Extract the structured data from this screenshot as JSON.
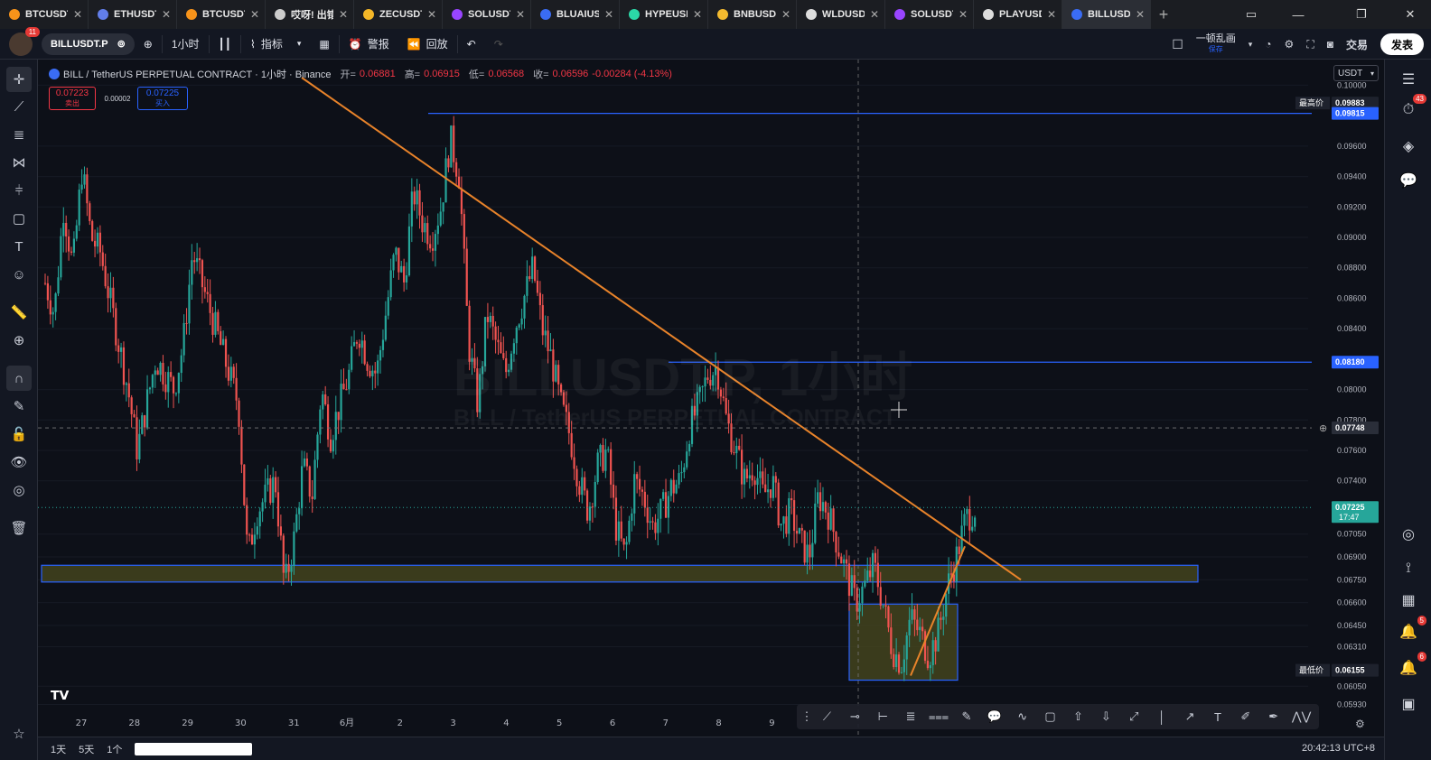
{
  "browser_tabs": [
    {
      "label": "BTCUSDT.P",
      "color": "#f7931a",
      "active": false
    },
    {
      "label": "ETHUSDT.P",
      "color": "#627eea",
      "active": false
    },
    {
      "label": "BTCUSDT.P",
      "color": "#f7931a",
      "active": false
    },
    {
      "label": "哎呀! 出错",
      "color": "#cccccc",
      "active": false
    },
    {
      "label": "ZECUSDT.P",
      "color": "#f4b728",
      "active": false
    },
    {
      "label": "SOLUSDT.P",
      "color": "#9945ff",
      "active": false
    },
    {
      "label": "BLUAIUSDT",
      "color": "#3a6cf4",
      "active": false
    },
    {
      "label": "HYPEUSDT.",
      "color": "#2bd7a7",
      "active": false
    },
    {
      "label": "BNBUSDT.P",
      "color": "#f3ba2f",
      "active": false
    },
    {
      "label": "WLDUSDT.P",
      "color": "#dddddd",
      "active": false
    },
    {
      "label": "SOLUSDT.P",
      "color": "#9945ff",
      "active": false
    },
    {
      "label": "PLAYUSDT.",
      "color": "#dddddd",
      "active": false
    },
    {
      "label": "BILLUSDT.P",
      "color": "#3a6cf4",
      "active": true
    }
  ],
  "toolbar": {
    "avatar_badge": "11",
    "symbol": "BILLUSDT.P",
    "interval": "1小时",
    "indicators_label": "指标",
    "alert_label": "警报",
    "replay_label": "回放",
    "layout_name": "一顿乱画",
    "layout_status": "保存",
    "trade_label": "交易",
    "publish_label": "发表"
  },
  "legend": {
    "title": "BILL / TetherUS PERPETUAL CONTRACT · 1小时 · Binance",
    "open_label": "开=",
    "open": "0.06881",
    "high_label": "高=",
    "high": "0.06915",
    "low_label": "低=",
    "low": "0.06568",
    "close_label": "收=",
    "close": "0.06596",
    "change": "-0.00284 (-4.13%)"
  },
  "quote": {
    "sell_price": "0.07223",
    "sell_label": "卖出",
    "spread": "0.00002",
    "buy_price": "0.07225",
    "buy_label": "买入"
  },
  "watermark": {
    "big": "BILLUSDT.P, 1小时",
    "small": "BILL / TetherUS PERPETUAL CONTRACT"
  },
  "currency": "USDT",
  "price_axis": {
    "ticks": [
      "0.10000",
      "0.09600",
      "0.09400",
      "0.09200",
      "0.09000",
      "0.08800",
      "0.08600",
      "0.08400",
      "0.08000",
      "0.07800",
      "0.07600",
      "0.07400",
      "0.07050",
      "0.06900",
      "0.06750",
      "0.06600",
      "0.06450",
      "0.06310",
      "0.06050",
      "0.05930"
    ],
    "labels": [
      {
        "price": 0.09883,
        "text": "0.09883",
        "tag": "最高价",
        "style": "dark"
      },
      {
        "price": 0.09815,
        "text": "0.09815",
        "style": "blue"
      },
      {
        "price": 0.0818,
        "text": "0.08180",
        "style": "blue"
      },
      {
        "price": 0.07748,
        "text": "0.07748",
        "style": "crosshair"
      },
      {
        "price": 0.07225,
        "text": "0.07225",
        "sub": "17:47",
        "style": "green"
      },
      {
        "price": 0.06155,
        "text": "0.06155",
        "tag": "最低价",
        "style": "dark"
      }
    ]
  },
  "time_axis": [
    "27",
    "28",
    "29",
    "30",
    "31",
    "6月",
    "2",
    "3",
    "4",
    "5",
    "6",
    "7",
    "8",
    "9"
  ],
  "bottom": {
    "ranges": [
      "1天",
      "5天",
      "1个"
    ],
    "clock": "20:42:13 UTC+8"
  },
  "right_badges": {
    "watchlist": "43",
    "notifications": "5",
    "alerts": "6"
  },
  "colors": {
    "up": "#26a69a",
    "down": "#ef5350",
    "trendline": "#e8832a",
    "hline": "#2962ff",
    "zone_fill": "#4a4a1e"
  },
  "chart_data": {
    "type": "candlestick",
    "title": "BILL / TetherUS PERPETUAL CONTRACT · 1小时 · Binance",
    "xlabel": "",
    "ylabel": "",
    "x_categories": [
      "27",
      "28",
      "29",
      "30",
      "31",
      "6月",
      "2",
      "3",
      "4",
      "5",
      "6",
      "7",
      "8",
      "9"
    ],
    "ylim": [
      0.0585,
      0.1005
    ],
    "price_path": [
      [
        0.087,
        0.085
      ],
      [
        0.092,
        0.088
      ],
      [
        0.0945,
        0.09
      ],
      [
        0.089,
        0.086
      ],
      [
        0.083,
        0.08
      ],
      [
        0.076,
        0.079
      ],
      [
        0.082,
        0.081
      ],
      [
        0.08,
        0.083
      ],
      [
        0.089,
        0.087
      ],
      [
        0.085,
        0.083
      ],
      [
        0.081,
        0.079
      ],
      [
        0.069,
        0.072
      ],
      [
        0.073,
        0.074
      ],
      [
        0.067,
        0.07
      ],
      [
        0.075,
        0.073
      ],
      [
        0.08,
        0.077
      ],
      [
        0.079,
        0.081
      ],
      [
        0.084,
        0.082
      ],
      [
        0.081,
        0.085
      ],
      [
        0.089,
        0.087
      ],
      [
        0.093,
        0.091
      ],
      [
        0.09,
        0.092
      ],
      [
        0.0965,
        0.094
      ],
      [
        0.083,
        0.079
      ],
      [
        0.085,
        0.083
      ],
      [
        0.081,
        0.084
      ],
      [
        0.086,
        0.088
      ],
      [
        0.084,
        0.082
      ],
      [
        0.079,
        0.077
      ],
      [
        0.074,
        0.072
      ],
      [
        0.075,
        0.076
      ],
      [
        0.071,
        0.069
      ],
      [
        0.074,
        0.073
      ],
      [
        0.071,
        0.072
      ],
      [
        0.0735,
        0.074
      ],
      [
        0.0775,
        0.079
      ],
      [
        0.081,
        0.0815
      ],
      [
        0.078,
        0.076
      ],
      [
        0.074,
        0.075
      ],
      [
        0.073,
        0.074
      ],
      [
        0.071,
        0.072
      ],
      [
        0.07,
        0.069
      ],
      [
        0.073,
        0.072
      ],
      [
        0.07,
        0.068
      ],
      [
        0.066,
        0.067
      ],
      [
        0.0685,
        0.066
      ],
      [
        0.063,
        0.062
      ],
      [
        0.065,
        0.064
      ],
      [
        0.0625,
        0.064
      ],
      [
        0.067,
        0.069
      ],
      [
        0.0715,
        0.0722
      ]
    ],
    "horizontal_lines": [
      0.09815,
      0.0818
    ],
    "support_zone": [
      0.06735,
      0.06845
    ],
    "accumulation_box": [
      0.0609,
      0.0659
    ],
    "downtrend_line": [
      [
        0.1005,
        0.0675
      ]
    ],
    "last_price": 0.07225,
    "high": 0.09883,
    "low": 0.06155
  }
}
